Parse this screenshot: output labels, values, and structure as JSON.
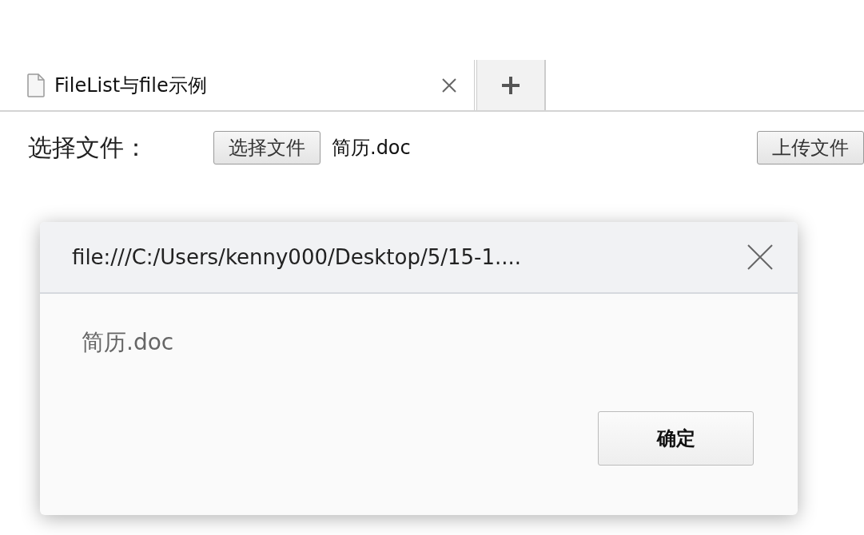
{
  "tabs": [
    {
      "title": "FileList与file示例",
      "selected": true
    }
  ],
  "page": {
    "label": "选择文件：",
    "choose_button": "选择文件",
    "file_name": "简历.doc",
    "upload_button": "上传文件"
  },
  "dialog": {
    "title": "file:///C:/Users/kenny000/Desktop/5/15-1....",
    "message": "简历.doc",
    "ok_button": "确定"
  }
}
